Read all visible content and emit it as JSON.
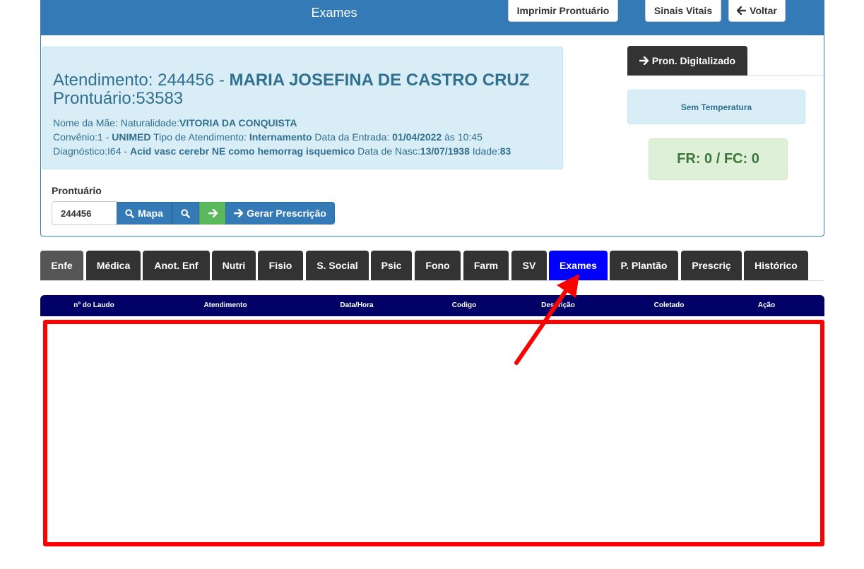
{
  "header": {
    "title": "Exames",
    "print_label": "Imprimir Prontuário",
    "vitals_label": "Sinais Vitais",
    "back_label": "Voltar"
  },
  "patient": {
    "atend_prefix": "Atendimento: 244456 - ",
    "name": "MARIA JOSEFINA DE CASTRO CRUZ",
    "prontuario_line": "Prontuário:53583",
    "mae_label": "Nome da Mãe: Naturalidade:",
    "naturalidade": "VITORIA DA CONQUISTA",
    "convenio_label": "Convênio:1 - ",
    "convenio": "UNIMED",
    "tipo_label": " Tipo de Atendimento: ",
    "tipo": "Internamento",
    "entrada_label": " Data da Entrada: ",
    "entrada_date": "01/04/2022",
    "entrada_as": " às 10:45",
    "diag_label": "Diagnóstico:I64 - ",
    "diagnostico": "Acid vasc cerebr NE como hemorrag isquemico",
    "nasc_label": " Data de Nasc:",
    "nasc": "13/07/1938",
    "idade_label": " Idade:",
    "idade": "83"
  },
  "prontuario_form": {
    "label": "Prontuário",
    "value": "244456",
    "mapa_label": "Mapa",
    "gerar_label": "Gerar Prescrição"
  },
  "side": {
    "pron_digital_label": "Pron. Digitalizado",
    "temperature": "Sem Temperatura",
    "fr_fc": "FR: 0 / FC: 0"
  },
  "tabs": [
    "Enfe",
    "Médica",
    "Anot. Enf",
    "Nutri",
    "Fisio",
    "S. Social",
    "Psic",
    "Fono",
    "Farm",
    "SV",
    "Exames",
    "P. Plantão",
    "Prescriç",
    "Histórico"
  ],
  "active_tab": "Exames",
  "table": {
    "headers": [
      "nº do Laudo",
      "Atendimento",
      "Data/Hora",
      "Codigo",
      "Descrição",
      "Coletado",
      "Ação"
    ]
  },
  "colors": {
    "primary": "#337ab7",
    "active_tab": "#0000ff",
    "table_header": "#000066",
    "highlight": "#ff0000"
  }
}
